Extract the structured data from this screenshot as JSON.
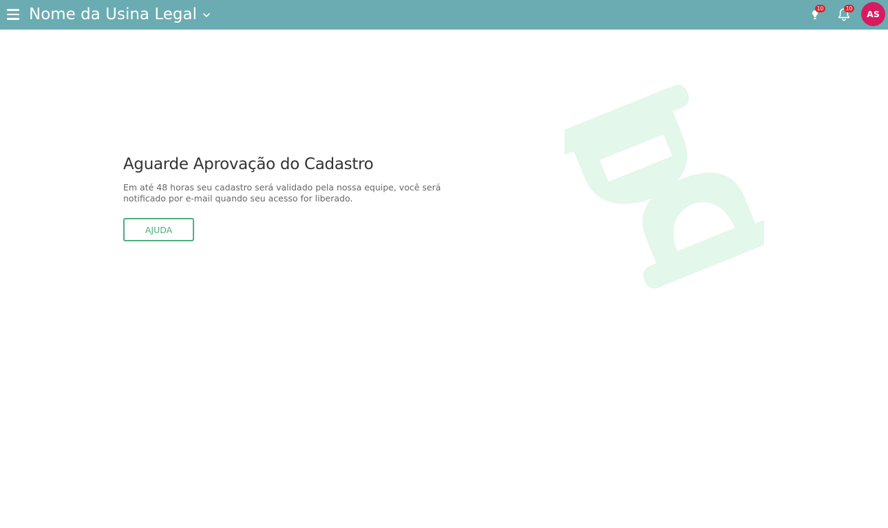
{
  "header": {
    "title": "Nome da Usina Legal",
    "hint_badge": "10",
    "notification_badge": "10",
    "avatar_initials": "AS"
  },
  "main": {
    "heading": "Aguarde Aprovação do Cadastro",
    "description": "Em até 48 horas seu cadastro será validado pela nossa equipe, você será notificado por e-mail quando seu acesso for liberado.",
    "help_button": "AJUDA",
    "illustration_icon": "hourglass-icon"
  },
  "colors": {
    "topbar": "#6aacb2",
    "accent": "#4ab07a",
    "avatar": "#d81b60",
    "badge": "#d9232e",
    "illustration": "#e3f7ea"
  }
}
